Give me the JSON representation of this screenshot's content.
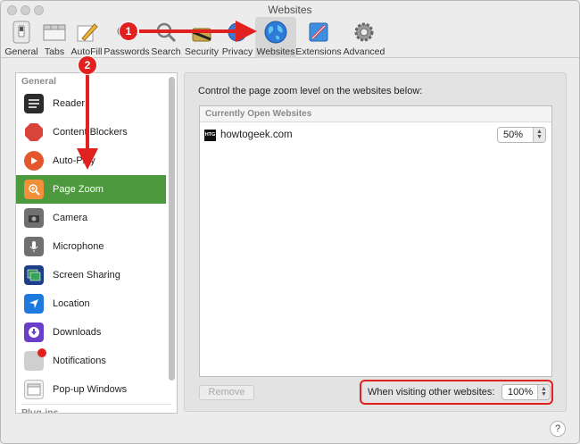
{
  "window": {
    "title": "Websites"
  },
  "toolbar": {
    "items": [
      {
        "label": "General",
        "icon": "general-switch-icon"
      },
      {
        "label": "Tabs",
        "icon": "tabs-icon"
      },
      {
        "label": "AutoFill",
        "icon": "autofill-pencil-icon"
      },
      {
        "label": "Passwords",
        "icon": "key-icon"
      },
      {
        "label": "Search",
        "icon": "magnifier-icon"
      },
      {
        "label": "Security",
        "icon": "security-icon"
      },
      {
        "label": "Privacy",
        "icon": "privacy-icon"
      },
      {
        "label": "Websites",
        "icon": "globe-icon",
        "active": true
      },
      {
        "label": "Extensions",
        "icon": "extensions-icon"
      },
      {
        "label": "Advanced",
        "icon": "gear-icon"
      }
    ]
  },
  "sidebar": {
    "general_header": "General",
    "plugins_header": "Plug-ins",
    "items": [
      {
        "label": "Reader",
        "icon": "reader-icon",
        "color": "#2b2b2b"
      },
      {
        "label": "Content Blockers",
        "icon": "stop-sign-icon",
        "color": "#d9443a"
      },
      {
        "label": "Auto-Play",
        "icon": "play-icon",
        "color": "#e2582c"
      },
      {
        "label": "Page Zoom",
        "icon": "zoom-icon",
        "color": "#f0903a",
        "selected": true
      },
      {
        "label": "Camera",
        "icon": "camera-icon",
        "color": "#707070"
      },
      {
        "label": "Microphone",
        "icon": "microphone-icon",
        "color": "#707070"
      },
      {
        "label": "Screen Sharing",
        "icon": "screen-sharing-icon",
        "color": "#2f8a4a"
      },
      {
        "label": "Location",
        "icon": "location-arrow-icon",
        "color": "#1f7ae0"
      },
      {
        "label": "Downloads",
        "icon": "downloads-icon",
        "color": "#6a3ec9"
      },
      {
        "label": "Notifications",
        "icon": "notifications-icon",
        "color": "#bdbdbd"
      },
      {
        "label": "Pop-up Windows",
        "icon": "popup-windows-icon",
        "color": "#e9e9e9"
      }
    ]
  },
  "main": {
    "intro": "Control the page zoom level on the websites below:",
    "list_header": "Currently Open Websites",
    "sites": [
      {
        "favicon": "HTG",
        "name": "howtogeek.com",
        "zoom": "50%"
      }
    ],
    "remove_label": "Remove",
    "other_label": "When visiting other websites:",
    "other_zoom": "100%"
  },
  "annotations": [
    {
      "number": "1",
      "color": "#e0211f"
    },
    {
      "number": "2",
      "color": "#e0211f"
    }
  ],
  "help_label": "?"
}
